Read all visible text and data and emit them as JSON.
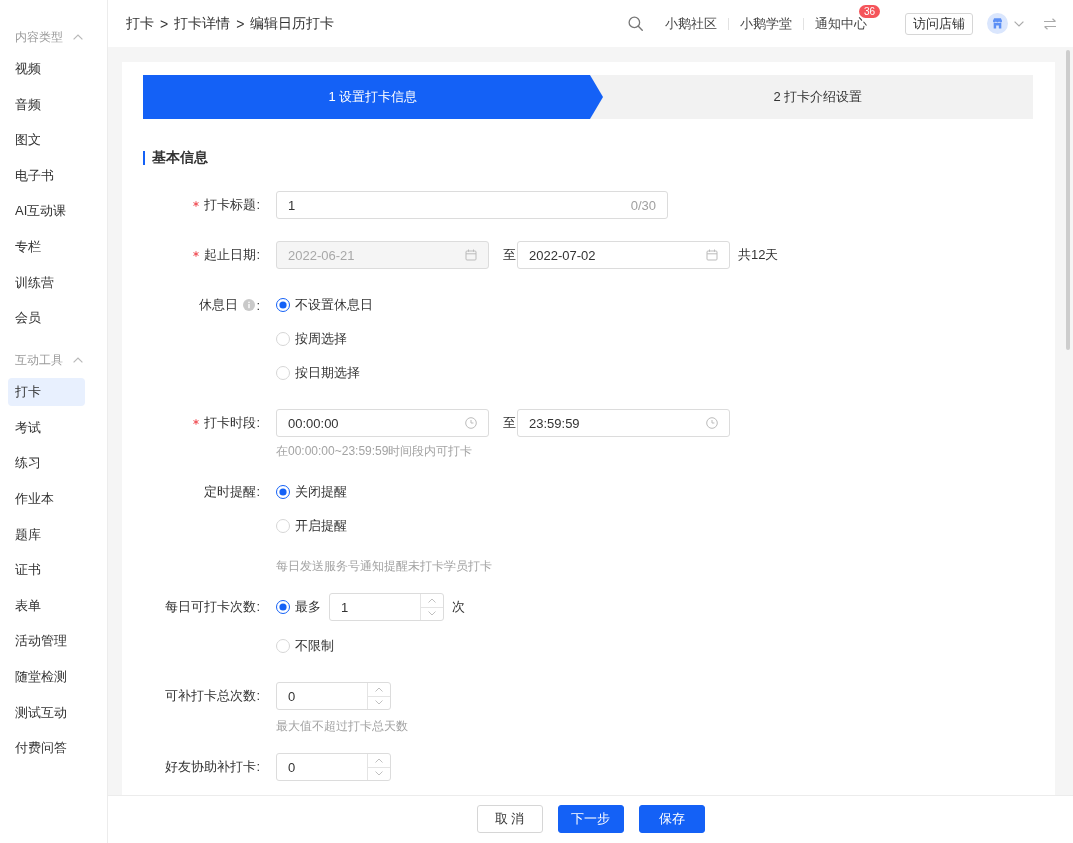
{
  "sidebar": {
    "groups": [
      {
        "title": "内容类型",
        "expanded": true,
        "items": [
          {
            "label": "视频",
            "selected": false
          },
          {
            "label": "音频",
            "selected": false
          },
          {
            "label": "图文",
            "selected": false
          },
          {
            "label": "电子书",
            "selected": false
          },
          {
            "label": "AI互动课",
            "selected": false
          },
          {
            "label": "专栏",
            "selected": false
          },
          {
            "label": "训练营",
            "selected": false
          },
          {
            "label": "会员",
            "selected": false
          }
        ]
      },
      {
        "title": "互动工具",
        "expanded": true,
        "items": [
          {
            "label": "打卡",
            "selected": true
          },
          {
            "label": "考试",
            "selected": false
          },
          {
            "label": "练习",
            "selected": false
          },
          {
            "label": "作业本",
            "selected": false
          },
          {
            "label": "题库",
            "selected": false
          },
          {
            "label": "证书",
            "selected": false
          },
          {
            "label": "表单",
            "selected": false
          },
          {
            "label": "活动管理",
            "selected": false
          },
          {
            "label": "随堂检测",
            "selected": false
          },
          {
            "label": "测试互动",
            "selected": false
          },
          {
            "label": "付费问答",
            "selected": false
          }
        ]
      }
    ]
  },
  "header": {
    "breadcrumb": [
      {
        "kind": "link",
        "text": "打卡"
      },
      {
        "kind": "separator",
        "text": ">"
      },
      {
        "kind": "link",
        "text": "打卡详情"
      },
      {
        "kind": "separator",
        "text": ">"
      },
      {
        "kind": "current",
        "text": "编辑日历打卡"
      }
    ],
    "nav_links": [
      {
        "label": "小鹅社区"
      },
      {
        "label": "小鹅学堂"
      },
      {
        "label": "通知中心",
        "badge": "36"
      }
    ],
    "visit_store_button": "访问店铺"
  },
  "steps": [
    {
      "label": "1 设置打卡信息",
      "selected": true
    },
    {
      "label": "2 打卡介绍设置",
      "selected": false
    }
  ],
  "section_title": "基本信息",
  "form": {
    "rows": [
      {
        "kind": "text",
        "label": "打卡标题:",
        "required": true,
        "value": "1",
        "counter": "0/30"
      },
      {
        "kind": "date_range",
        "label": "起止日期:",
        "required": true,
        "start": {
          "value": "2022-06-21",
          "disabled": true
        },
        "separator": "至",
        "end": {
          "value": "2022-07-02",
          "disabled": false
        },
        "suffix": "共12天"
      },
      {
        "kind": "radio_group",
        "label": "休息日",
        "info": true,
        "label_suffix": ":",
        "required": false,
        "options": [
          {
            "label": "不设置休息日",
            "selected": true
          },
          {
            "label": "按周选择",
            "selected": false
          },
          {
            "label": "按日期选择",
            "selected": false
          }
        ]
      },
      {
        "kind": "time_range",
        "label": "打卡时段:",
        "required": true,
        "start": {
          "value": "00:00:00",
          "disabled": false
        },
        "separator": "至",
        "end": {
          "value": "23:59:59",
          "disabled": false
        },
        "help": "在00:00:00~23:59:59时间段内可打卡"
      },
      {
        "kind": "radio_group",
        "label": "定时提醒:",
        "required": false,
        "options": [
          {
            "label": "关闭提醒",
            "selected": true
          },
          {
            "label": "开启提醒",
            "selected": false
          }
        ],
        "help": "每日发送服务号通知提醒未打卡学员打卡"
      },
      {
        "kind": "radio_group",
        "label": "每日可打卡次数:",
        "required": false,
        "options": [
          {
            "label": "最多",
            "selected": true,
            "number": {
              "value": "1",
              "unit": "次"
            }
          },
          {
            "label": "不限制",
            "selected": false
          }
        ]
      },
      {
        "kind": "number",
        "label": "可补打卡总次数:",
        "required": false,
        "value": "0",
        "help": "最大值不超过打卡总天数"
      },
      {
        "kind": "number",
        "label": "好友协助补打卡:",
        "required": false,
        "value": "0"
      }
    ]
  },
  "footer": {
    "buttons": [
      {
        "kind": "default",
        "label": "取 消"
      },
      {
        "kind": "primary",
        "label": "下一步"
      },
      {
        "kind": "primary",
        "label": "保存"
      }
    ]
  }
}
